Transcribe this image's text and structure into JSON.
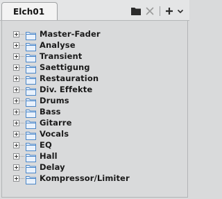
{
  "tab": {
    "title": "Elch01"
  },
  "toolbar": {
    "icons": [
      "folder-icon",
      "close-icon",
      "add-icon",
      "chevron-down-icon"
    ],
    "icon_color": "#2b2b2b",
    "disabled_color": "#9a9a9a"
  },
  "tree": {
    "items": [
      {
        "label": "Master-Fader",
        "icon": "folder-icon"
      },
      {
        "label": "Analyse",
        "icon": "folder-icon"
      },
      {
        "label": "Transient",
        "icon": "folder-icon"
      },
      {
        "label": "Saettigung",
        "icon": "folder-icon"
      },
      {
        "label": "Restauration",
        "icon": "folder-icon"
      },
      {
        "label": "Div. Effekte",
        "icon": "folder-icon"
      },
      {
        "label": "Drums",
        "icon": "folder-icon"
      },
      {
        "label": "Bass",
        "icon": "folder-icon"
      },
      {
        "label": "Gitarre",
        "icon": "folder-icon"
      },
      {
        "label": "Vocals",
        "icon": "folder-icon"
      },
      {
        "label": "EQ",
        "icon": "folder-icon"
      },
      {
        "label": "Hall",
        "icon": "folder-icon"
      },
      {
        "label": "Delay",
        "icon": "folder-icon"
      },
      {
        "label": "Kompressor/Limiter",
        "icon": "folder-icon"
      }
    ]
  },
  "colors": {
    "panel_bg": "#d9dadb",
    "tab_bg": "#f3f3f3",
    "folder_outline": "#4a86c8",
    "folder_fill": "#e9f1fb"
  }
}
